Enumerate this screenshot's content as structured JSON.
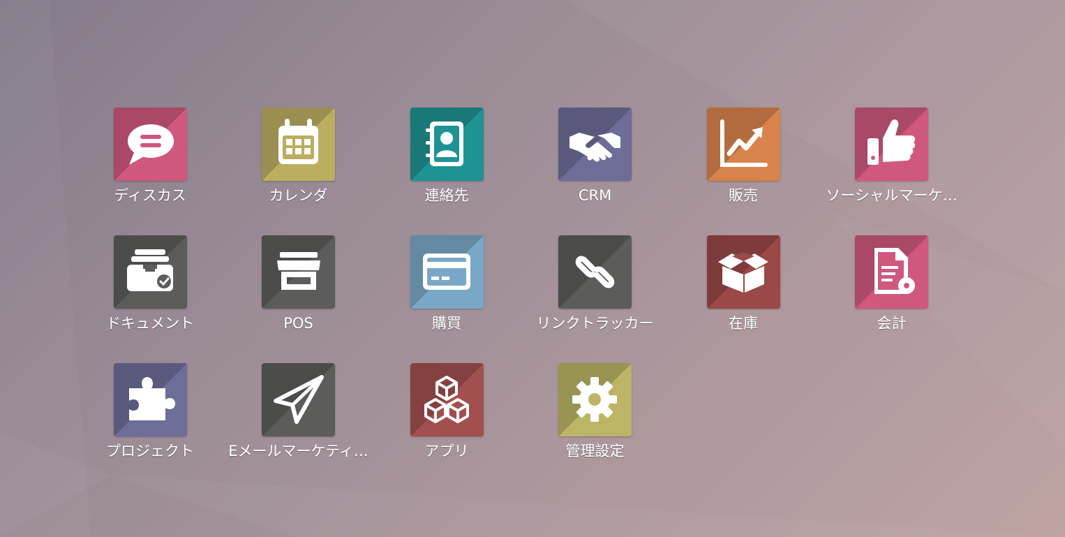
{
  "apps": [
    {
      "label": "ディスカス",
      "icon": "chat-bubble-icon",
      "color": "#d0587e"
    },
    {
      "label": "カレンダ",
      "icon": "calendar-icon",
      "color": "#bcae61"
    },
    {
      "label": "連絡先",
      "icon": "address-book-icon",
      "color": "#1f9393"
    },
    {
      "label": "CRM",
      "icon": "handshake-icon",
      "color": "#6e6d98"
    },
    {
      "label": "販売",
      "icon": "sales-chart-icon",
      "color": "#d9834c"
    },
    {
      "label": "ソーシャルマーケ…",
      "icon": "thumbs-up-icon",
      "color": "#d0587e"
    },
    {
      "label": "ドキュメント",
      "icon": "document-tray-icon",
      "color": "#5c5c5a"
    },
    {
      "label": "POS",
      "icon": "store-icon",
      "color": "#5c5c5a"
    },
    {
      "label": "購買",
      "icon": "credit-card-icon",
      "color": "#79a8c6"
    },
    {
      "label": "リンクトラッカー",
      "icon": "link-icon",
      "color": "#5c5c5a"
    },
    {
      "label": "在庫",
      "icon": "box-icon",
      "color": "#9b4848"
    },
    {
      "label": "会計",
      "icon": "invoice-gear-icon",
      "color": "#d0587e"
    },
    {
      "label": "プロジェクト",
      "icon": "puzzle-icon",
      "color": "#6e6d98"
    },
    {
      "label": "Eメールマーケティ…",
      "icon": "paper-plane-icon",
      "color": "#5c5c5a"
    },
    {
      "label": "アプリ",
      "icon": "cubes-icon",
      "color": "#a24f4f"
    },
    {
      "label": "管理設定",
      "icon": "gear-icon",
      "color": "#bcb565"
    }
  ]
}
